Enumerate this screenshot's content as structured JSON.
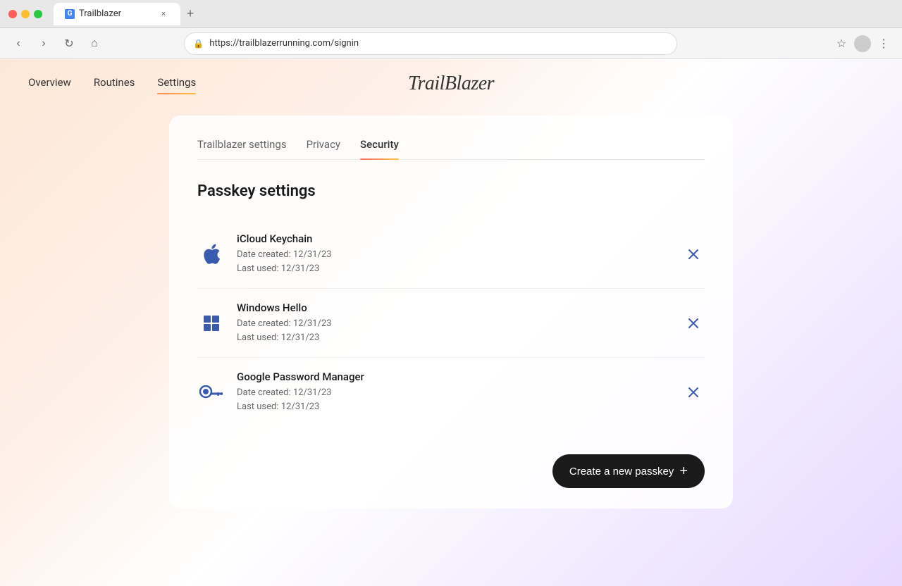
{
  "browser": {
    "tab_title": "Trailblazer",
    "url": "https://trailblazerrunning.com/signin",
    "new_tab_label": "+",
    "close_tab_label": "×"
  },
  "nav": {
    "back_label": "‹",
    "forward_label": "›",
    "refresh_label": "↻",
    "home_label": "⌂",
    "bookmark_label": "☆",
    "menu_label": "⋮"
  },
  "top_nav": {
    "logo": "TrailBlazer",
    "links": [
      {
        "label": "Overview",
        "active": false
      },
      {
        "label": "Routines",
        "active": false
      },
      {
        "label": "Settings",
        "active": true
      }
    ]
  },
  "settings": {
    "tabs": [
      {
        "label": "Trailblazer settings",
        "active": false
      },
      {
        "label": "Privacy",
        "active": false
      },
      {
        "label": "Security",
        "active": true
      }
    ],
    "section_title": "Passkey settings",
    "passkeys": [
      {
        "name": "iCloud Keychain",
        "icon_type": "apple",
        "date_created": "Date created: 12/31/23",
        "last_used": "Last used: 12/31/23"
      },
      {
        "name": "Windows Hello",
        "icon_type": "windows",
        "date_created": "Date created: 12/31/23",
        "last_used": "Last used: 12/31/23"
      },
      {
        "name": "Google Password Manager",
        "icon_type": "key",
        "date_created": "Date created: 12/31/23",
        "last_used": "Last used: 12/31/23"
      }
    ],
    "create_button_label": "Create a new passkey",
    "create_button_plus": "+"
  }
}
